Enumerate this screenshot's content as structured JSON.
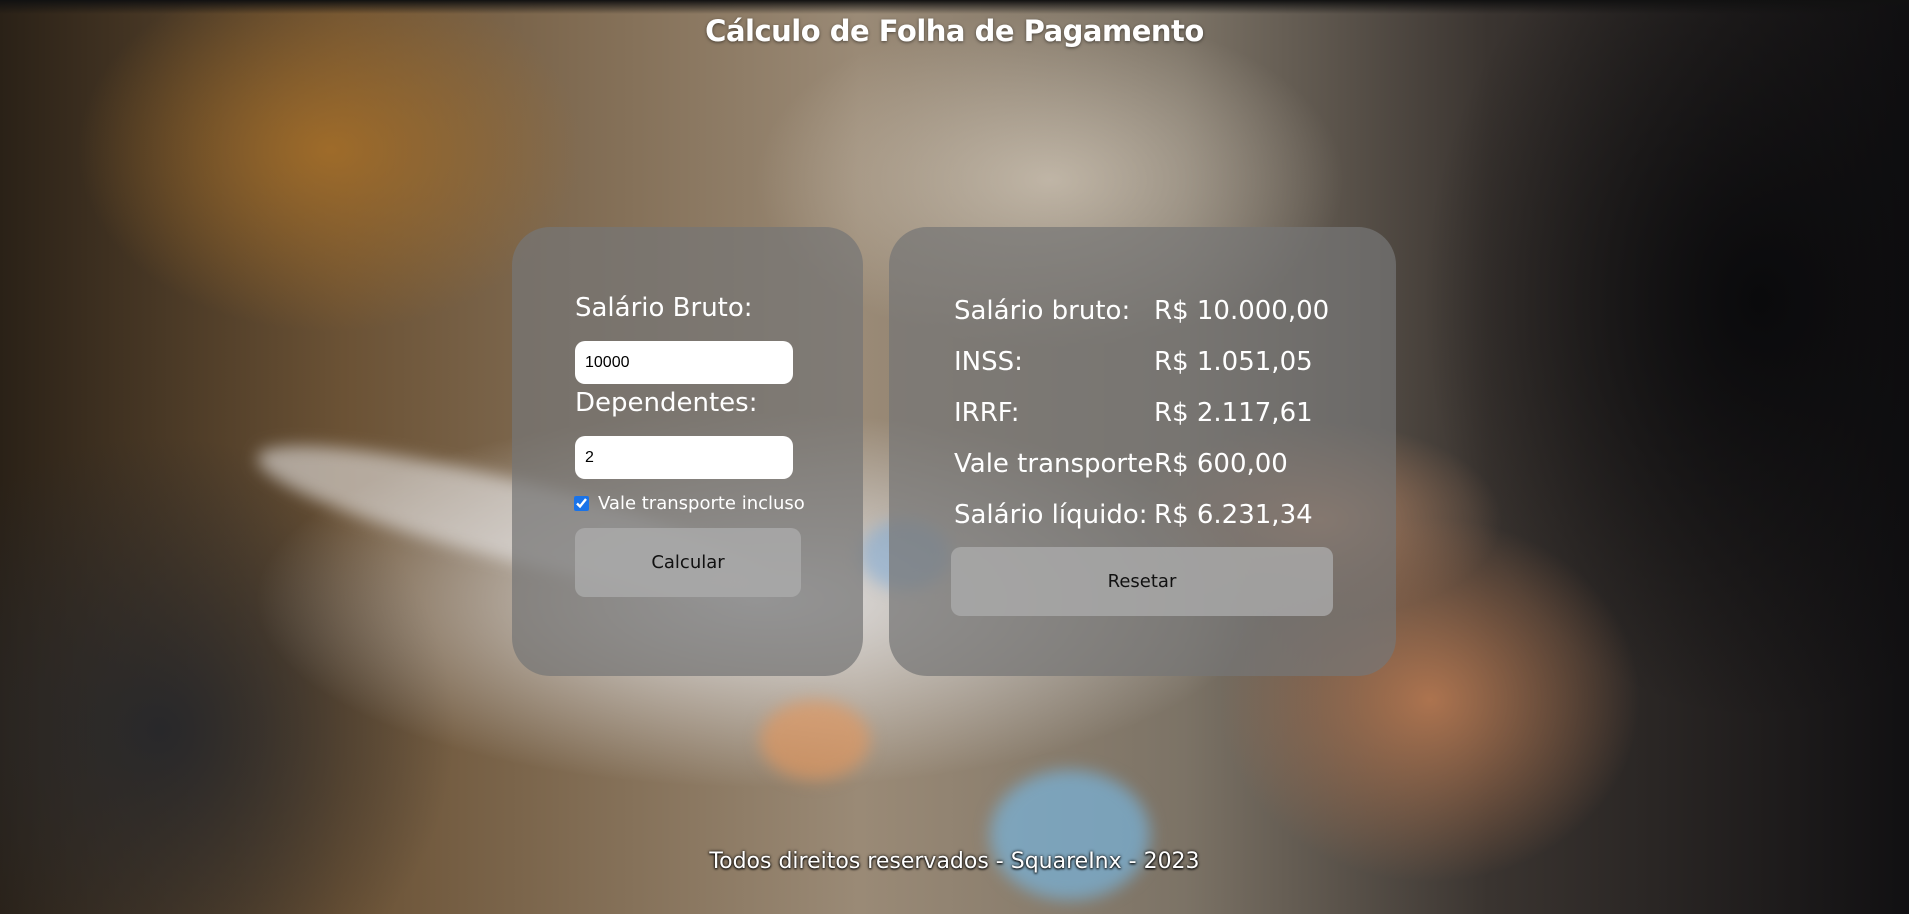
{
  "header": {
    "title": "Cálculo de Folha de Pagamento"
  },
  "form": {
    "salary_label": "Salário Bruto:",
    "salary_value": "10000",
    "dependents_label": "Dependentes:",
    "dependents_value": "2",
    "transport_checked": true,
    "transport_label": "Vale transporte incluso",
    "calculate_label": "Calcular"
  },
  "results": {
    "rows": [
      {
        "label": "Salário bruto:",
        "value": "R$ 10.000,00"
      },
      {
        "label": "INSS:",
        "value": "R$ 1.051,05"
      },
      {
        "label": "IRRF:",
        "value": "R$ 2.117,61"
      },
      {
        "label": "Vale transporte:",
        "value": "R$ 600,00"
      },
      {
        "label": "Salário líquido:",
        "value": "R$ 6.231,34"
      }
    ],
    "reset_label": "Resetar"
  },
  "footer": {
    "text": "Todos direitos reservados - SquareInx - 2023"
  }
}
